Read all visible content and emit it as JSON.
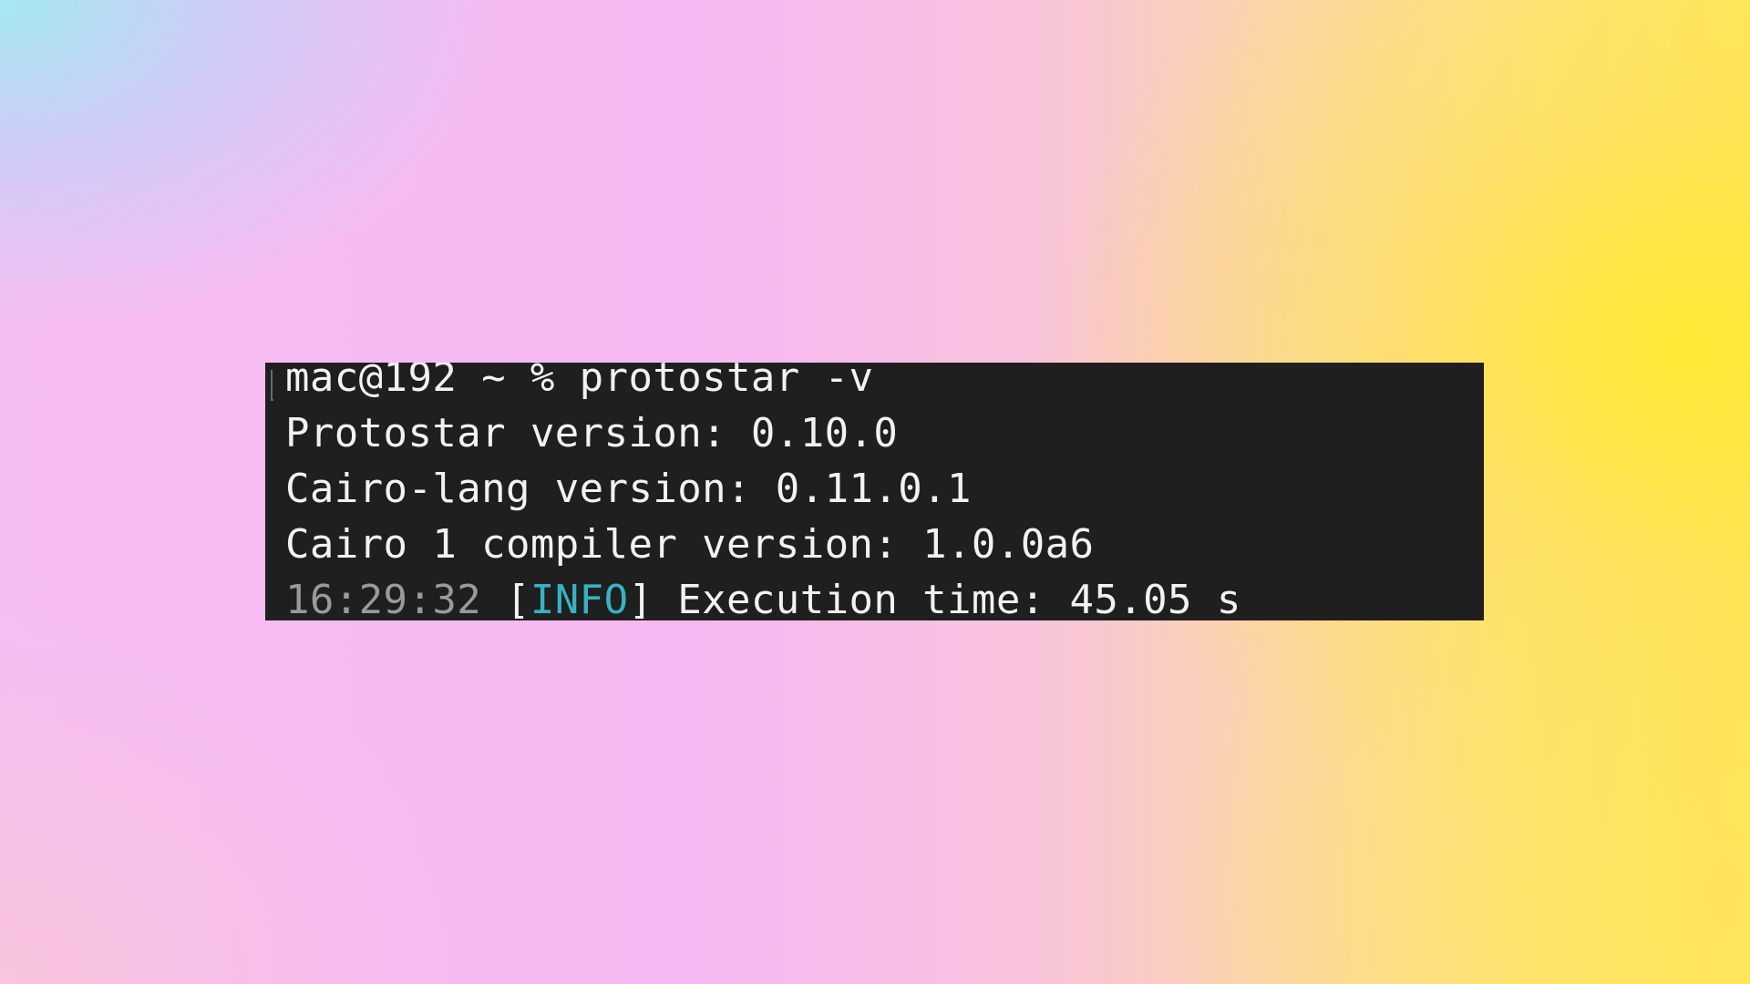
{
  "terminal": {
    "prompt": "mac@192 ~ % protostar -v",
    "lines": [
      "Protostar version: 0.10.0",
      "Cairo-lang version: 0.11.0.1",
      "Cairo 1 compiler version: 1.0.0a6"
    ],
    "log": {
      "timestamp": "16:29:32",
      "open_bracket": " [",
      "level": "INFO",
      "message": "] Execution time: 45.05 s"
    }
  },
  "colors": {
    "terminal_bg": "#1f1f1f",
    "text": "#f2f2f2",
    "timestamp": "#9a9a9a",
    "info": "#36b2c5"
  }
}
